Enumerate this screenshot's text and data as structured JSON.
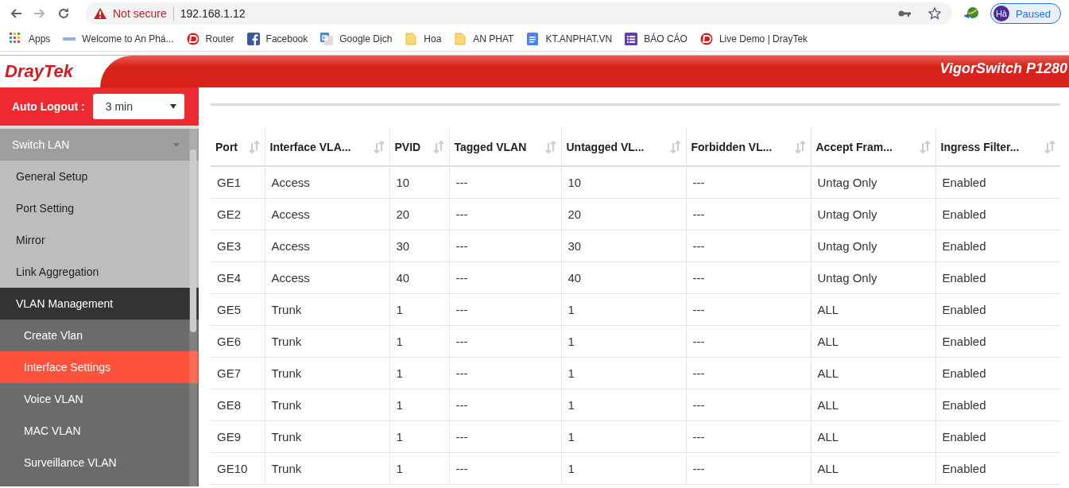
{
  "browser": {
    "security": "Not secure",
    "url": "192.168.1.12",
    "profile": {
      "initials": "Hà",
      "status": "Paused"
    }
  },
  "bookmarks": [
    {
      "label": "Apps",
      "kind": "apps"
    },
    {
      "label": "Welcome to An Phá...",
      "kind": "site"
    },
    {
      "label": "Router",
      "kind": "draytek"
    },
    {
      "label": "Facebook",
      "kind": "facebook"
    },
    {
      "label": "Google Dịch",
      "kind": "translate"
    },
    {
      "label": "Hoa",
      "kind": "folder"
    },
    {
      "label": "AN PHAT",
      "kind": "folder"
    },
    {
      "label": "KT.ANPHAT.VN",
      "kind": "doc"
    },
    {
      "label": "BÁO CÁO",
      "kind": "form"
    },
    {
      "label": "Live Demo | DrayTek",
      "kind": "draytek"
    }
  ],
  "header": {
    "logo": "DrayTek",
    "product": "VigorSwitch P1280"
  },
  "auto_logout": {
    "label": "Auto Logout :",
    "value": "3 min"
  },
  "sidebar": {
    "items": [
      {
        "label": "Switch LAN",
        "expanded": true,
        "selected": false,
        "children": [
          {
            "label": "General Setup",
            "selected": false
          },
          {
            "label": "Port Setting",
            "selected": false
          },
          {
            "label": "Mirror",
            "selected": false
          },
          {
            "label": "Link Aggregation",
            "selected": false
          },
          {
            "label": "VLAN Management",
            "expanded": true,
            "selected": false,
            "children": [
              {
                "label": "Create Vlan",
                "selected": false
              },
              {
                "label": "Interface Settings",
                "selected": true
              },
              {
                "label": "Voice VLAN",
                "selected": false
              },
              {
                "label": "MAC VLAN",
                "selected": false
              },
              {
                "label": "Surveillance VLAN",
                "selected": false
              }
            ]
          }
        ]
      }
    ]
  },
  "table": {
    "columns": [
      "Port",
      "Interface VLA...",
      "PVID",
      "Tagged VLAN",
      "Untagged VL...",
      "Forbidden VL...",
      "Accept Fram...",
      "Ingress Filter..."
    ],
    "rows": [
      [
        "GE1",
        "Access",
        "10",
        "---",
        "10",
        "---",
        "Untag Only",
        "Enabled"
      ],
      [
        "GE2",
        "Access",
        "20",
        "---",
        "20",
        "---",
        "Untag Only",
        "Enabled"
      ],
      [
        "GE3",
        "Access",
        "30",
        "---",
        "30",
        "---",
        "Untag Only",
        "Enabled"
      ],
      [
        "GE4",
        "Access",
        "40",
        "---",
        "40",
        "---",
        "Untag Only",
        "Enabled"
      ],
      [
        "GE5",
        "Trunk",
        "1",
        "---",
        "1",
        "---",
        "ALL",
        "Enabled"
      ],
      [
        "GE6",
        "Trunk",
        "1",
        "---",
        "1",
        "---",
        "ALL",
        "Enabled"
      ],
      [
        "GE7",
        "Trunk",
        "1",
        "---",
        "1",
        "---",
        "ALL",
        "Enabled"
      ],
      [
        "GE8",
        "Trunk",
        "1",
        "---",
        "1",
        "---",
        "ALL",
        "Enabled"
      ],
      [
        "GE9",
        "Trunk",
        "1",
        "---",
        "1",
        "---",
        "ALL",
        "Enabled"
      ],
      [
        "GE10",
        "Trunk",
        "1",
        "---",
        "1",
        "---",
        "ALL",
        "Enabled"
      ]
    ]
  }
}
